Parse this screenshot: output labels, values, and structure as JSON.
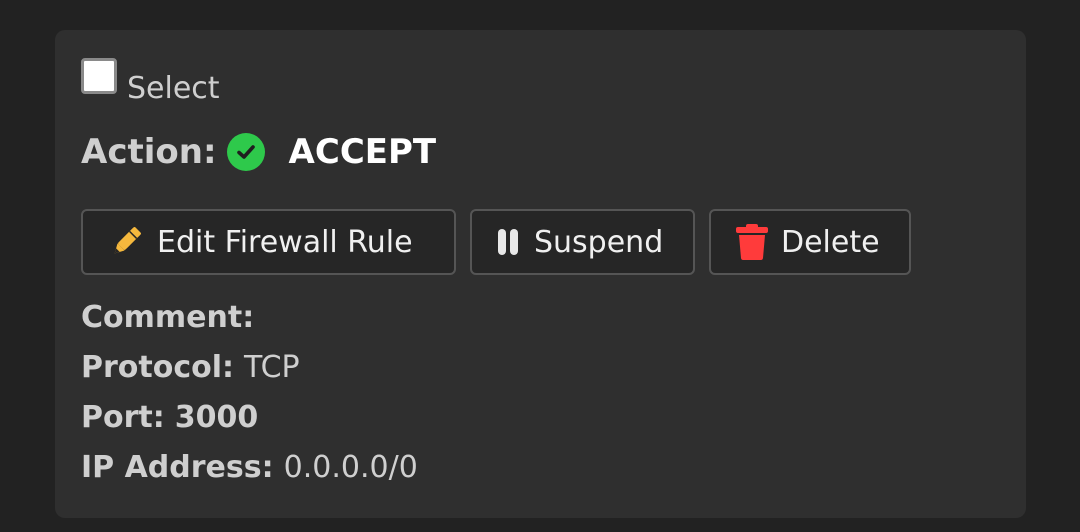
{
  "rule": {
    "select_label": "Select",
    "action_label": "Action:",
    "action_value": "ACCEPT",
    "action_icon": "check-circle-icon",
    "action_color": "#2ec94b"
  },
  "buttons": {
    "edit_label": "Edit Firewall Rule",
    "edit_icon": "pencil-icon",
    "suspend_label": "Suspend",
    "suspend_icon": "pause-icon",
    "delete_label": "Delete",
    "delete_icon": "trash-icon",
    "delete_color": "#ff3b3b"
  },
  "details": {
    "comment_label": "Comment:",
    "comment_value": "",
    "protocol_label": "Protocol:",
    "protocol_value": "TCP",
    "port_label": "Port:",
    "port_value": "3000",
    "ip_label": "IP Address:",
    "ip_value": "0.0.0.0/0"
  }
}
